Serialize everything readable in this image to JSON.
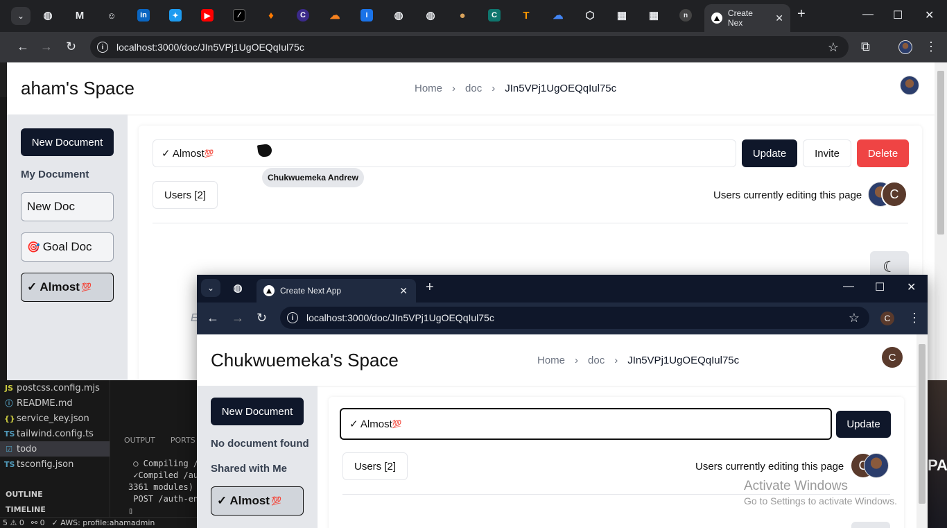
{
  "vscode": {
    "files": [
      {
        "icon": "JS",
        "name": "postcss.config.mjs"
      },
      {
        "icon": "ⓘ",
        "name": "README.md"
      },
      {
        "icon": "{}",
        "name": "service_key.json"
      },
      {
        "icon": "TS",
        "name": "tailwind.config.ts"
      },
      {
        "icon": "☑",
        "name": "todo"
      },
      {
        "icon": "TS",
        "name": "tsconfig.json"
      }
    ],
    "outline_label": "OUTLINE",
    "timeline_label": "TIMELINE",
    "panel_tabs": [
      "OUTPUT",
      "PORTS"
    ],
    "terminal_lines": [
      " ○ Compiling /a",
      " ✓Compiled /au",
      "3361 modules)",
      " POST /auth-end"
    ],
    "status": {
      "errors": "5 ⚠ 0",
      "ports": "⚯ 0",
      "aws": "✓ AWS: profile:ahamadmin"
    },
    "right_strip_text": "PA"
  },
  "browser": {
    "active_tab_title": "Create Nex",
    "url": "localhost:3000/doc/JIn5VPj1UgOEQqIul75c"
  },
  "page": {
    "space_title": "aham's Space",
    "breadcrumbs": [
      "Home",
      "doc",
      "JIn5VPj1UgOEQqIul75c"
    ],
    "breadcrumb_sep": "›",
    "new_document_label": "New Document",
    "my_document_label": "My Document",
    "documents": [
      {
        "label": "New Doc",
        "emoji": ""
      },
      {
        "label": "Goal Doc",
        "emoji": "🎯"
      },
      {
        "label": "✓ Almost",
        "emoji": "💯"
      }
    ],
    "title_value": "✓ Almost",
    "title_emoji": "💯",
    "update_label": "Update",
    "invite_label": "Invite",
    "delete_label": "Delete",
    "users_label": "Users [2]",
    "editing_label": "Users currently editing this page",
    "avatar_letter": "C",
    "cursor_user": "Chukwuemeka Andrew",
    "ghost_text": "E"
  },
  "window2": {
    "tab_title": "Create Next App",
    "url": "localhost:3000/doc/JIn5VPj1UgOEQqIul75c",
    "profile_letter": "C",
    "space_title": "Chukwuemeka's Space",
    "breadcrumbs": [
      "Home",
      "doc",
      "JIn5VPj1UgOEQqIul75c"
    ],
    "new_document_label": "New Document",
    "no_document_label": "No document found",
    "shared_label": "Shared with Me",
    "shared_doc": "✓ Almost",
    "shared_doc_emoji": "💯",
    "title_value": "✓ Almost",
    "title_emoji": "💯",
    "update_label": "Update",
    "users_label": "Users [2]",
    "editing_label": "Users currently editing this page",
    "avatar_letter": "C"
  },
  "watermark": {
    "title": "Activate Windows",
    "subtitle": "Go to Settings to activate Windows."
  }
}
